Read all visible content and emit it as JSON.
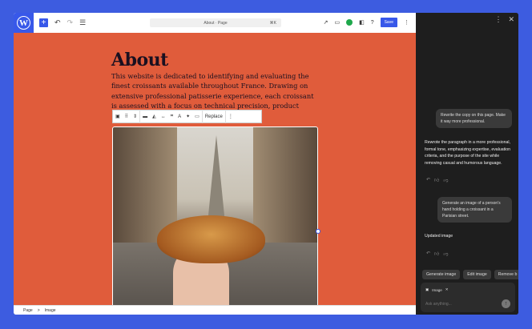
{
  "topbar": {
    "logo": "W",
    "doc_title": "About · Page",
    "shortcut": "⌘K",
    "save_label": "Save"
  },
  "page": {
    "title": "About",
    "paragraph": "This website is dedicated to identifying and evaluating the finest croissants available throughout France. Drawing on extensive professional patisserie experience, each croissant is assessed with a focus on technical precision, product"
  },
  "block_toolbar": {
    "replace_label": "Replace"
  },
  "breadcrumb": {
    "items": [
      "Page",
      "Image"
    ],
    "separator": ">"
  },
  "chat": {
    "messages": [
      {
        "role": "user",
        "text": "Rewrite the copy on this page. Make it way more professional."
      },
      {
        "role": "assistant",
        "text": "Rewrote the paragraph in a more professional, formal tone, emphasizing expertise, evaluation criteria, and the purpose of the site while removing casual and humorous language."
      },
      {
        "role": "user",
        "text": "Generate an image of a person's hand holding a croissant in a Parisian street."
      },
      {
        "role": "assistant",
        "text": "Updated image"
      }
    ],
    "suggestions": [
      "Generate image",
      "Edit image",
      "Remove b"
    ],
    "attachment": "Image",
    "placeholder": "Ask anything..."
  }
}
